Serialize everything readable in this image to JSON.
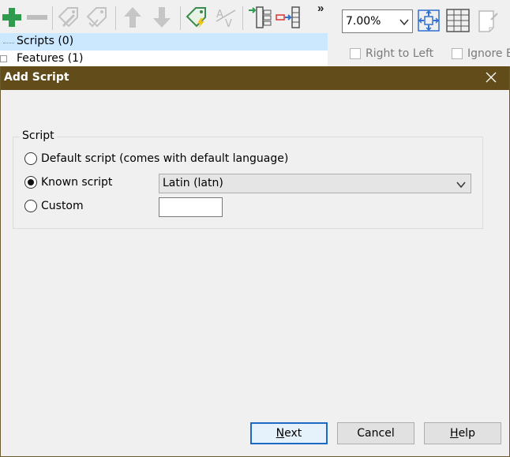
{
  "tree": {
    "items": [
      {
        "label": "Scripts (0)"
      },
      {
        "label": "Features (1)"
      }
    ]
  },
  "right_panel": {
    "zoom_value": "7.00%",
    "right_to_left_label": "Right to Left",
    "ignore_label": "Ignore E"
  },
  "dialog": {
    "title": "Add Script",
    "group_label": "Script",
    "radio_default_label": "Default script (comes with default language)",
    "radio_known_label": "Known script",
    "radio_custom_label": "Custom",
    "known_script_value": "Latin (latn)",
    "custom_value": "",
    "selected_option": "known",
    "buttons": {
      "next_first": "N",
      "next_rest": "ext",
      "cancel": "Cancel",
      "help_first": "H",
      "help_rest": "elp"
    }
  },
  "colors": {
    "titlebar": "#614c1a",
    "accent_green": "#2e9b4f",
    "selection": "#cce8ff",
    "default_button_border": "#1c6ac6"
  },
  "icons": [
    "plus-icon",
    "minus-icon",
    "tag-edit-icon",
    "tag-check-icon",
    "arrow-up-icon",
    "arrow-down-icon",
    "tag-lightning-icon",
    "text-sort-icon",
    "tree-add-icon",
    "tree-remove-icon",
    "fit-page-icon",
    "grid-icon",
    "page-icon",
    "close-icon",
    "chevron-down-icon"
  ]
}
